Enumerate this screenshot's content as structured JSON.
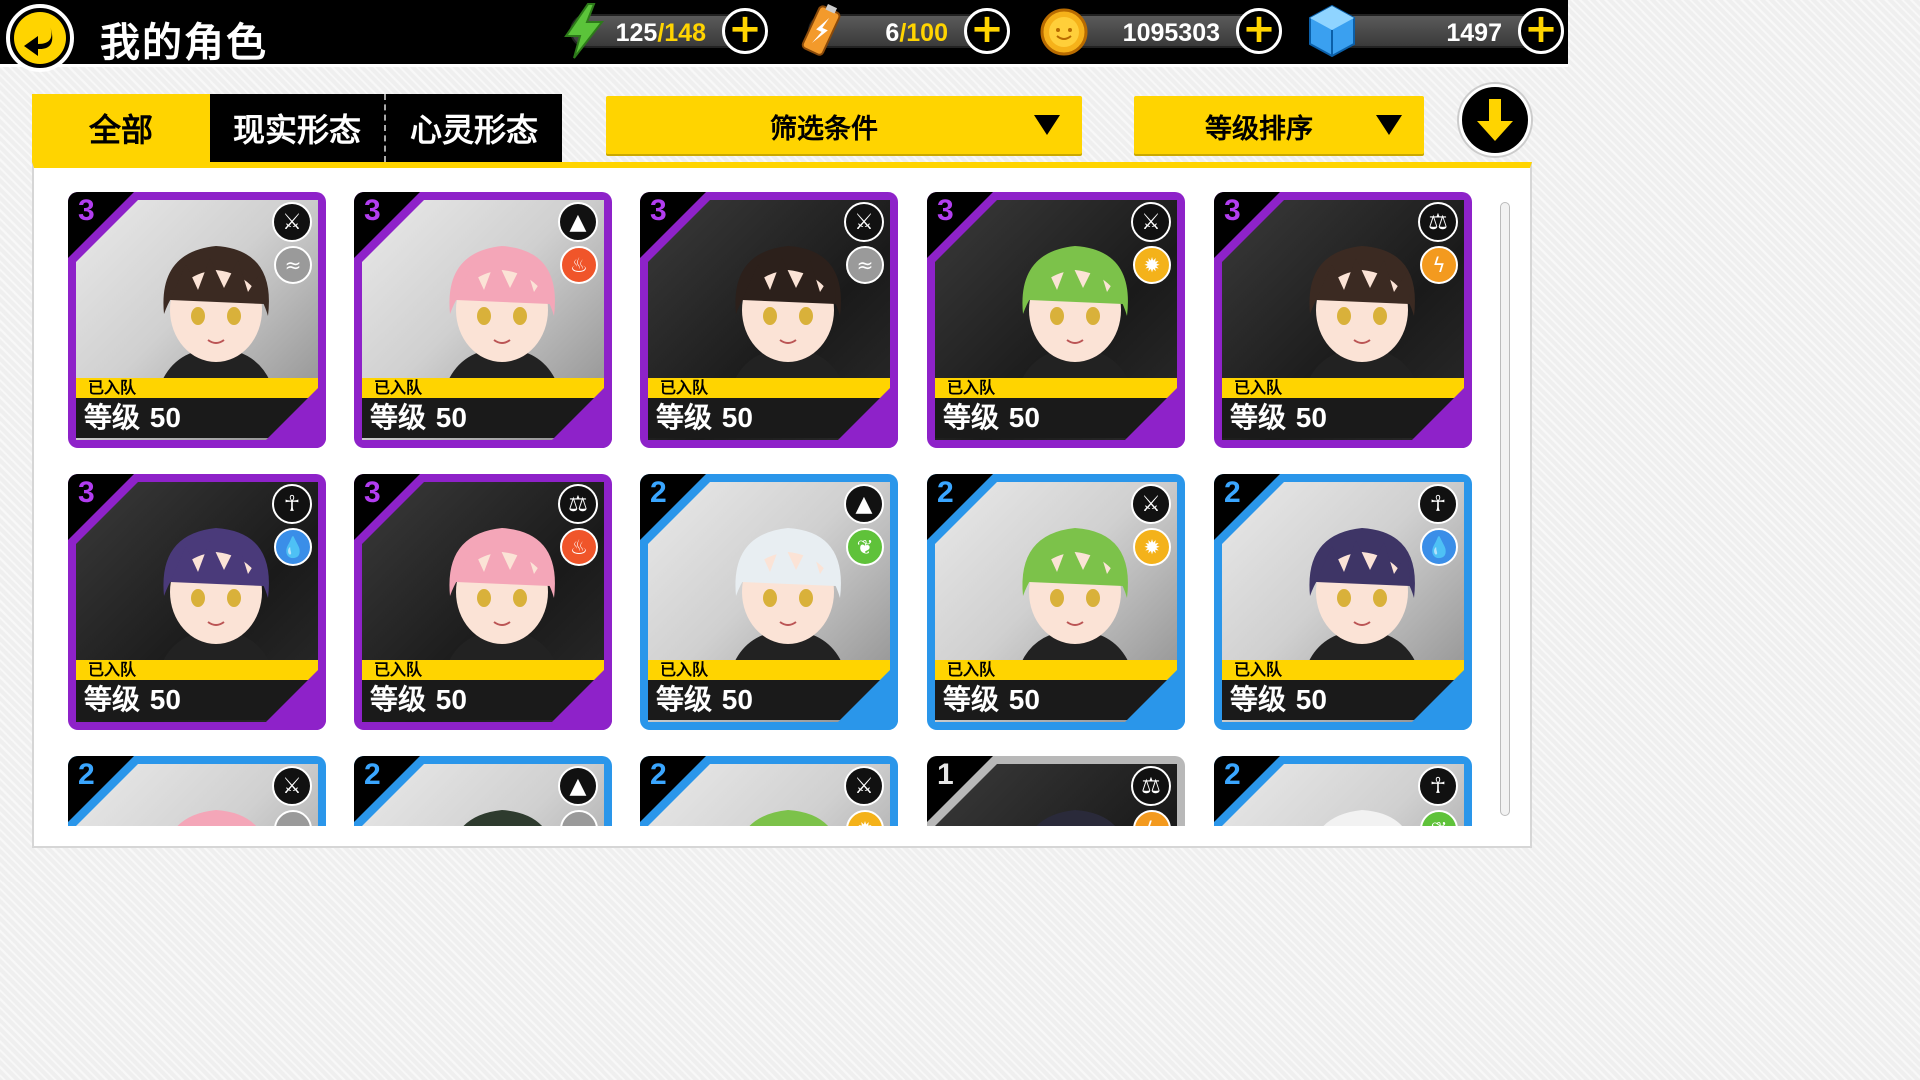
{
  "header": {
    "title": "我的角色",
    "stamina": {
      "current": "125",
      "max": "148"
    },
    "battery": {
      "current": "6",
      "max": "100"
    },
    "coins": "1095303",
    "gems": "1497",
    "plus_label": "+"
  },
  "tabs": [
    {
      "label": "全部",
      "active": true
    },
    {
      "label": "现实形态",
      "active": false
    },
    {
      "label": "心灵形态",
      "active": false
    }
  ],
  "filters": {
    "filter_label": "筛选条件",
    "sort_label": "等级排序"
  },
  "colors": {
    "accent": "#ffd400",
    "rarity3": "#8e22c9",
    "rarity2": "#2a96ea",
    "rarity1": "#b8b8b8"
  },
  "cards": [
    {
      "rarity": "3",
      "role": "sword",
      "element": "wind",
      "status": "已入队",
      "level_label": "等级",
      "level": "50",
      "hair": "#3b2a22",
      "bg": "light"
    },
    {
      "rarity": "3",
      "role": "triangle",
      "element": "fire",
      "status": "已入队",
      "level_label": "等级",
      "level": "50",
      "hair": "#f4a6b8",
      "bg": "light"
    },
    {
      "rarity": "3",
      "role": "sword",
      "element": "wind",
      "status": "已入队",
      "level_label": "等级",
      "level": "50",
      "hair": "#2c201b",
      "bg": "dark"
    },
    {
      "rarity": "3",
      "role": "sword",
      "element": "light",
      "status": "已入队",
      "level_label": "等级",
      "level": "50",
      "hair": "#7cc24a",
      "bg": "dark"
    },
    {
      "rarity": "3",
      "role": "balance",
      "element": "thunder",
      "status": "已入队",
      "level_label": "等级",
      "level": "50",
      "hair": "#3b2a22",
      "bg": "dark"
    },
    {
      "rarity": "3",
      "role": "ankh",
      "element": "water",
      "status": "已入队",
      "level_label": "等级",
      "level": "50",
      "hair": "#4a3a7a",
      "bg": "dark"
    },
    {
      "rarity": "3",
      "role": "balance",
      "element": "fire",
      "status": "已入队",
      "level_label": "等级",
      "level": "50",
      "hair": "#f4a6b8",
      "bg": "dark"
    },
    {
      "rarity": "2",
      "role": "triangle",
      "element": "leaf",
      "status": "已入队",
      "level_label": "等级",
      "level": "50",
      "hair": "#e8eef2",
      "bg": "light"
    },
    {
      "rarity": "2",
      "role": "sword",
      "element": "light",
      "status": "已入队",
      "level_label": "等级",
      "level": "50",
      "hair": "#7cc24a",
      "bg": "light"
    },
    {
      "rarity": "2",
      "role": "ankh",
      "element": "water",
      "status": "已入队",
      "level_label": "等级",
      "level": "50",
      "hair": "#3e3566",
      "bg": "light"
    },
    {
      "rarity": "2",
      "role": "sword",
      "element": "wind",
      "status": "",
      "level_label": "",
      "level": "",
      "hair": "#f4a6b8",
      "bg": "light"
    },
    {
      "rarity": "2",
      "role": "triangle",
      "element": "wind",
      "status": "",
      "level_label": "",
      "level": "",
      "hair": "#2e3b2e",
      "bg": "light"
    },
    {
      "rarity": "2",
      "role": "sword",
      "element": "light",
      "status": "",
      "level_label": "",
      "level": "",
      "hair": "#7cc24a",
      "bg": "light"
    },
    {
      "rarity": "1",
      "role": "balance",
      "element": "thunder",
      "status": "",
      "level_label": "",
      "level": "",
      "hair": "#2a2a3a",
      "bg": "dark"
    },
    {
      "rarity": "2",
      "role": "ankh",
      "element": "leaf",
      "status": "",
      "level_label": "",
      "level": "",
      "hair": "#f2f2f2",
      "bg": "light"
    }
  ]
}
